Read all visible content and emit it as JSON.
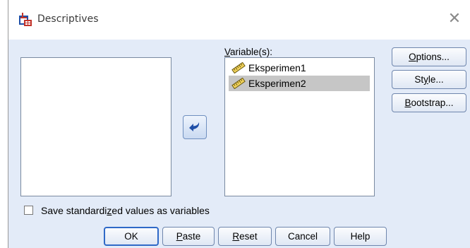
{
  "window": {
    "title": "Descriptives",
    "close_glyph": "✕"
  },
  "source_list": {
    "items": []
  },
  "target_list": {
    "label_pre": "",
    "label_mnemonic": "V",
    "label_post": "ariable(s):",
    "items": [
      {
        "name": "Eksperimen1",
        "icon": "ruler-scale-icon",
        "selected": false
      },
      {
        "name": "Eksperimen2",
        "icon": "ruler-scale-icon",
        "selected": true
      }
    ]
  },
  "move_button": {
    "icon": "arrow-left-icon"
  },
  "side_buttons": {
    "options": {
      "mnemonic": "O",
      "rest": "ptions..."
    },
    "style": {
      "pre": "St",
      "mnemonic": "y",
      "rest": "le..."
    },
    "bootstrap": {
      "mnemonic": "B",
      "rest": "ootstrap..."
    }
  },
  "save_checkbox": {
    "checked": false,
    "label_pre": "Save standardi",
    "label_mnemonic": "z",
    "label_post": "ed values as variables"
  },
  "bottom_buttons": {
    "ok": "OK",
    "paste": {
      "mnemonic": "P",
      "rest": "aste"
    },
    "reset": {
      "mnemonic": "R",
      "rest": "eset"
    },
    "cancel": "Cancel",
    "help": "Help"
  },
  "colors": {
    "client_bg": "#e3ebf8",
    "default_button_border": "#2f69c7",
    "selected_row": "#c6c6c6"
  }
}
